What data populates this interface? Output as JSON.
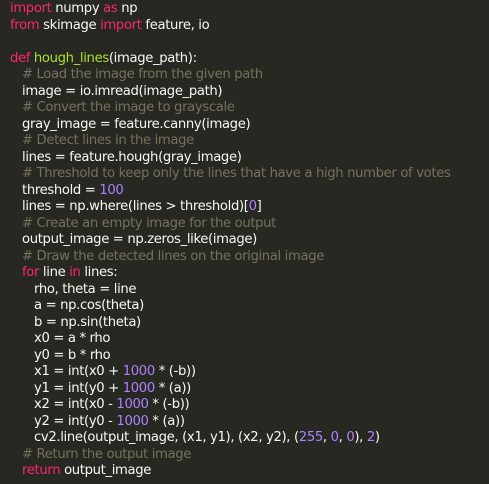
{
  "editor": {
    "colors": {
      "background": "#272822",
      "text": "#f8f8f2",
      "keyword": "#f92672",
      "function": "#a6e22e",
      "comment": "#75715e",
      "number": "#ae81ff"
    },
    "lines": {
      "l1": {
        "a": "import",
        "b": " numpy ",
        "c": "as",
        "d": " np"
      },
      "l2": {
        "a": "from",
        "b": " skimage ",
        "c": "import",
        "d": " feature, io"
      },
      "l4": {
        "a": "def ",
        "b": "hough_lines",
        "c": "(image_path):"
      },
      "l5": "# Load the image from the given path",
      "l6": "image = io.imread(image_path)",
      "l7": "# Convert the image to grayscale",
      "l8": "gray_image = feature.canny(image)",
      "l9": "# Detect lines in the image",
      "l10": "lines = feature.hough(gray_image)",
      "l11": "# Threshold to keep only the lines that have a high number of votes",
      "l12": {
        "a": "threshold = ",
        "b": "100"
      },
      "l13": {
        "a": "lines = np.where(lines > threshold)[",
        "b": "0",
        "c": "]"
      },
      "l14": "# Create an empty image for the output",
      "l15": "output_image = np.zeros_like(image)",
      "l16": "# Draw the detected lines on the original image",
      "l17": {
        "a": "for",
        "b": " line ",
        "c": "in",
        "d": " lines:"
      },
      "l18": "rho, theta = line",
      "l19": "a = np.cos(theta)",
      "l20": "b = np.sin(theta)",
      "l21": "x0 = a * rho",
      "l22": "y0 = b * rho",
      "l23": {
        "a": "x1 = int(x0 + ",
        "b": "1000",
        "c": " * (-b))"
      },
      "l24": {
        "a": "y1 = int(y0 + ",
        "b": "1000",
        "c": " * (a))"
      },
      "l25": {
        "a": "x2 = int(x0 - ",
        "b": "1000",
        "c": " * (-b))"
      },
      "l26": {
        "a": "y2 = int(y0 - ",
        "b": "1000",
        "c": " * (a))"
      },
      "l27": {
        "a": "cv2.line(output_image, (x1, y1), (x2, y2), (",
        "b": "255",
        "c": ", ",
        "d": "0",
        "e": ", ",
        "f": "0",
        "g": "), ",
        "h": "2",
        "i": ")"
      },
      "l28": "# Return the output image",
      "l29": {
        "a": "return",
        "b": " output_image"
      }
    }
  }
}
